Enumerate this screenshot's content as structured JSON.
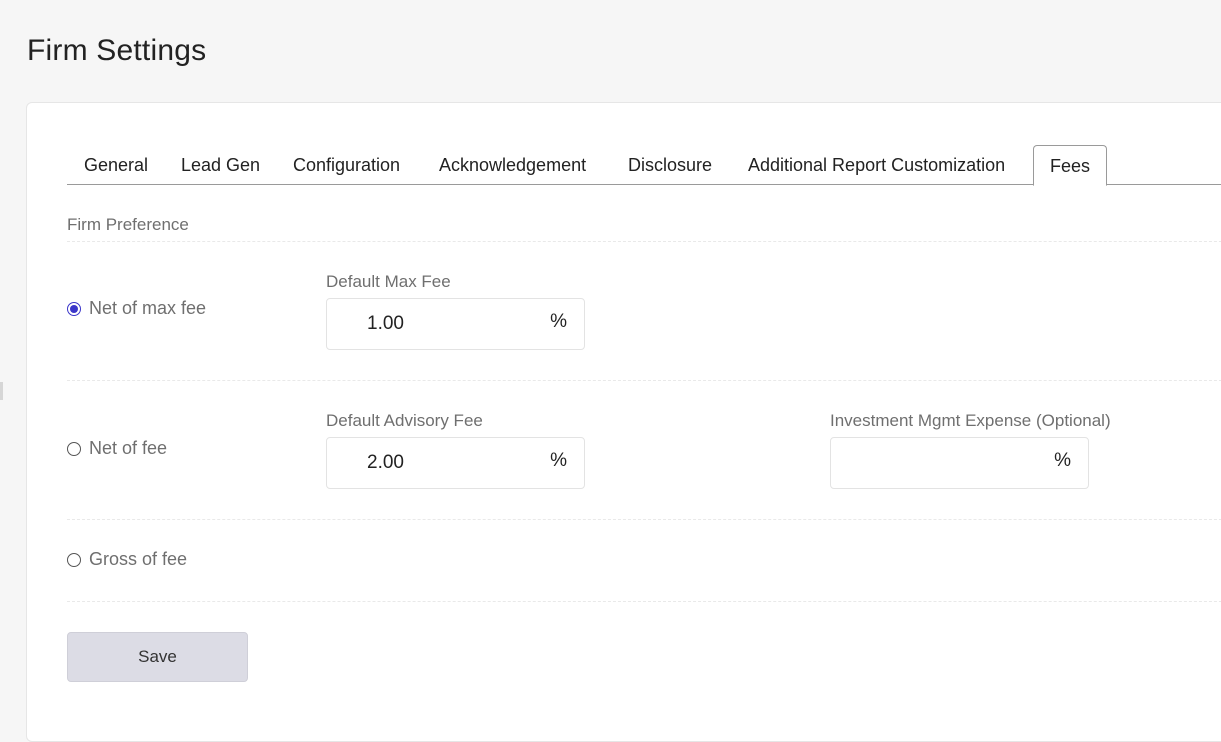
{
  "page": {
    "title": "Firm Settings"
  },
  "tabs": [
    {
      "label": "General"
    },
    {
      "label": "Lead Gen"
    },
    {
      "label": "Configuration"
    },
    {
      "label": "Acknowledgement"
    },
    {
      "label": "Disclosure"
    },
    {
      "label": "Additional Report Customization"
    },
    {
      "label": "Fees",
      "active": true
    }
  ],
  "firm_preference": {
    "label": "Firm Preference",
    "options": [
      {
        "label": "Net of max fee",
        "checked": true,
        "fields": [
          {
            "label": "Default Max Fee",
            "value": "1.00",
            "unit": "%"
          }
        ]
      },
      {
        "label": "Net of fee",
        "checked": false,
        "fields": [
          {
            "label": "Default Advisory Fee",
            "value": "2.00",
            "unit": "%"
          },
          {
            "label": "Investment Mgmt Expense (Optional)",
            "value": "",
            "unit": "%"
          }
        ]
      },
      {
        "label": "Gross of fee",
        "checked": false,
        "fields": []
      }
    ]
  },
  "actions": {
    "save_label": "Save"
  },
  "colors": {
    "accent": "#3b36c9",
    "button_bg": "#dcdce5",
    "page_bg": "#f6f6f6"
  }
}
